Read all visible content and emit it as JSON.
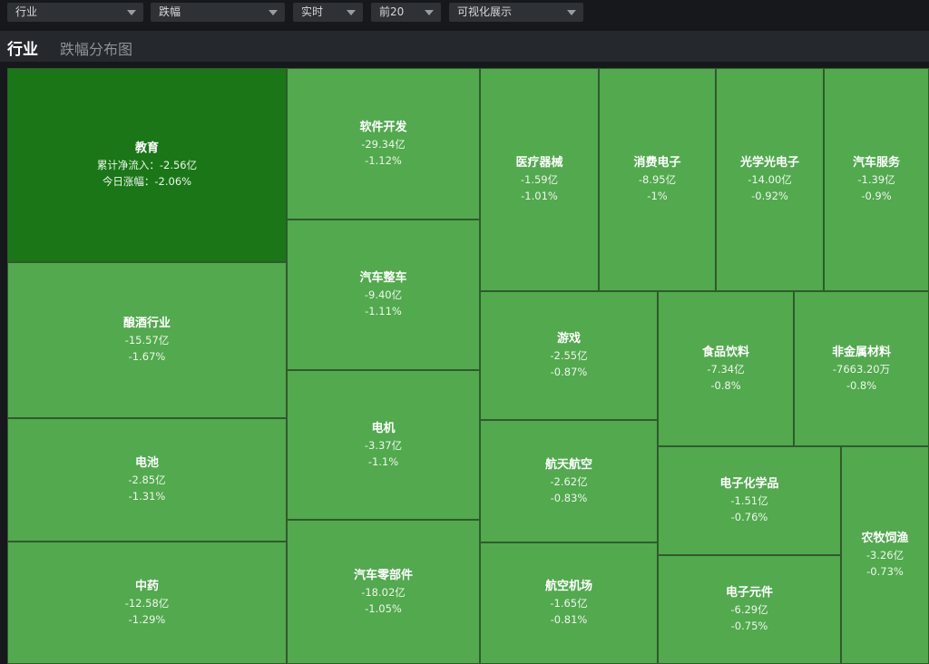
{
  "filters": [
    {
      "value": "行业"
    },
    {
      "value": "跌幅"
    },
    {
      "value": "实时"
    },
    {
      "value": "前20"
    },
    {
      "value": "可视化展示"
    }
  ],
  "header": {
    "active_tab": "行业",
    "tab": "跌幅分布图"
  },
  "colors": {
    "cell": "#52a94e",
    "cell_highlight": "#1a7617",
    "background": "#16181b",
    "header": "#25292d"
  },
  "treemap": [
    {
      "name": "教育",
      "line2": "累计净流入：-2.56亿",
      "line3": "今日涨幅：-2.06%"
    },
    {
      "name": "酿酒行业",
      "line2": "-15.57亿",
      "line3": "-1.67%"
    },
    {
      "name": "电池",
      "line2": "-2.85亿",
      "line3": "-1.31%"
    },
    {
      "name": "中药",
      "line2": "-12.58亿",
      "line3": "-1.29%"
    },
    {
      "name": "软件开发",
      "line2": "-29.34亿",
      "line3": "-1.12%"
    },
    {
      "name": "汽车整车",
      "line2": "-9.40亿",
      "line3": "-1.11%"
    },
    {
      "name": "电机",
      "line2": "-3.37亿",
      "line3": "-1.1%"
    },
    {
      "name": "汽车零部件",
      "line2": "-18.02亿",
      "line3": "-1.05%"
    },
    {
      "name": "医疗器械",
      "line2": "-1.59亿",
      "line3": "-1.01%"
    },
    {
      "name": "消费电子",
      "line2": "-8.95亿",
      "line3": "-1%"
    },
    {
      "name": "光学光电子",
      "line2": "-14.00亿",
      "line3": "-0.92%"
    },
    {
      "name": "汽车服务",
      "line2": "-1.39亿",
      "line3": "-0.9%"
    },
    {
      "name": "游戏",
      "line2": "-2.55亿",
      "line3": "-0.87%"
    },
    {
      "name": "食品饮料",
      "line2": "-7.34亿",
      "line3": "-0.8%"
    },
    {
      "name": "非金属材料",
      "line2": "-7663.20万",
      "line3": "-0.8%"
    },
    {
      "name": "航天航空",
      "line2": "-2.62亿",
      "line3": "-0.83%"
    },
    {
      "name": "电子化学品",
      "line2": "-1.51亿",
      "line3": "-0.76%"
    },
    {
      "name": "航空机场",
      "line2": "-1.65亿",
      "line3": "-0.81%"
    },
    {
      "name": "电子元件",
      "line2": "-6.29亿",
      "line3": "-0.75%"
    },
    {
      "name": "农牧饲渔",
      "line2": "-3.26亿",
      "line3": "-0.73%"
    }
  ]
}
